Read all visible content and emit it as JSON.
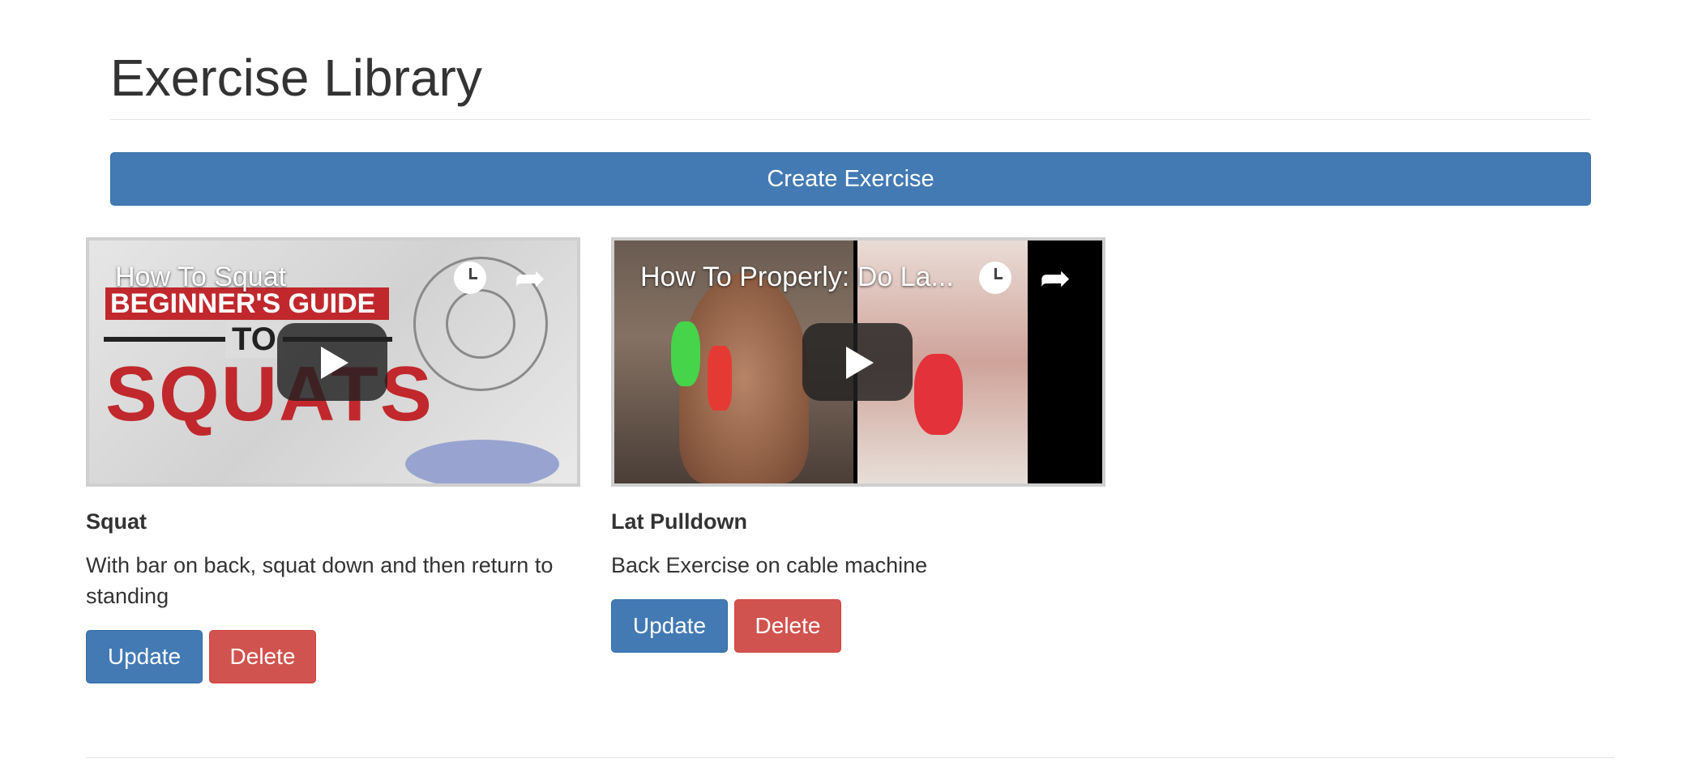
{
  "header": {
    "title": "Exercise Library"
  },
  "actions": {
    "create_label": "Create Exercise"
  },
  "exercises": [
    {
      "name": "Squat",
      "description": "With bar on back, squat down and then return to standing",
      "video_title": "How To Squat",
      "thumbnail_text": {
        "banner": "BEGINNER'S GUIDE",
        "to": "TO",
        "main": "SQUATS"
      },
      "update_label": "Update",
      "delete_label": "Delete"
    },
    {
      "name": "Lat Pulldown",
      "description": "Back Exercise on cable machine",
      "video_title": "How To Properly: Do La...",
      "update_label": "Update",
      "delete_label": "Delete"
    }
  ],
  "icons": {
    "watch_later": "clock-icon",
    "share": "share-icon",
    "play": "play-icon"
  },
  "colors": {
    "primary": "#437ab4",
    "danger": "#d1534f",
    "text": "#333333"
  }
}
